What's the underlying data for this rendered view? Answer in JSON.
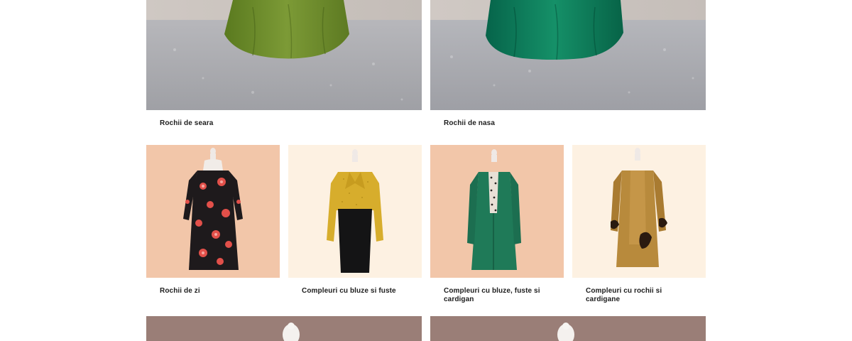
{
  "categories_top": [
    {
      "label": "Rochii de seara",
      "image": "green-evening-gown-photo",
      "color": "#6c8a2e"
    },
    {
      "label": "Rochii de nasa",
      "image": "emerald-gown-photo",
      "color": "#0f7a55"
    }
  ],
  "categories_middle": [
    {
      "label": "Rochii de zi",
      "image": "floral-dress-photo",
      "background": "#f2c6a9"
    },
    {
      "label": "Compleuri cu bluze si fuste",
      "image": "mustard-blouse-skirt-photo",
      "background": "#fdf1e2"
    },
    {
      "label": "Compleuri cu bluze, fuste si cardigan",
      "image": "green-cardigan-set-photo",
      "background": "#f2c6a9"
    },
    {
      "label": "Compleuri cu rochii si cardigane",
      "image": "ochre-dress-cardigan-photo",
      "background": "#fdf1e2"
    }
  ],
  "categories_bottom": [
    {
      "image": "mannequin-photo",
      "background": "#9a7e77"
    },
    {
      "image": "mannequin-photo",
      "background": "#9a7e77"
    }
  ]
}
